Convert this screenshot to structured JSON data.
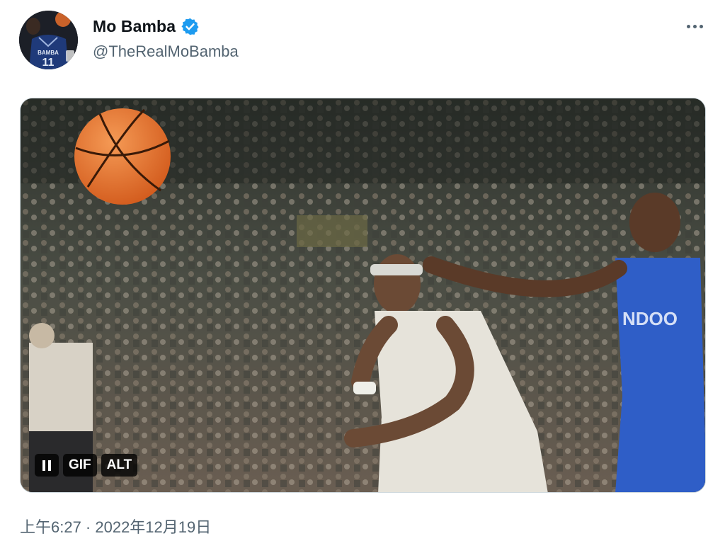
{
  "author": {
    "display_name": "Mo Bamba",
    "handle": "@TheRealMoBamba",
    "verified": true,
    "avatar_jersey_name": "BAMBA",
    "avatar_jersey_number": "11"
  },
  "media": {
    "type": "gif",
    "pause_label": "pause",
    "gif_badge": "GIF",
    "alt_badge": "ALT"
  },
  "timestamp": "上午6:27 · 2022年12月19日",
  "icons": {
    "verified": "verified-badge-icon",
    "more": "more-options-icon",
    "pause": "pause-icon"
  },
  "colors": {
    "verified_blue": "#1d9bf0",
    "secondary_text": "#536471",
    "primary_text": "#0f1419"
  }
}
